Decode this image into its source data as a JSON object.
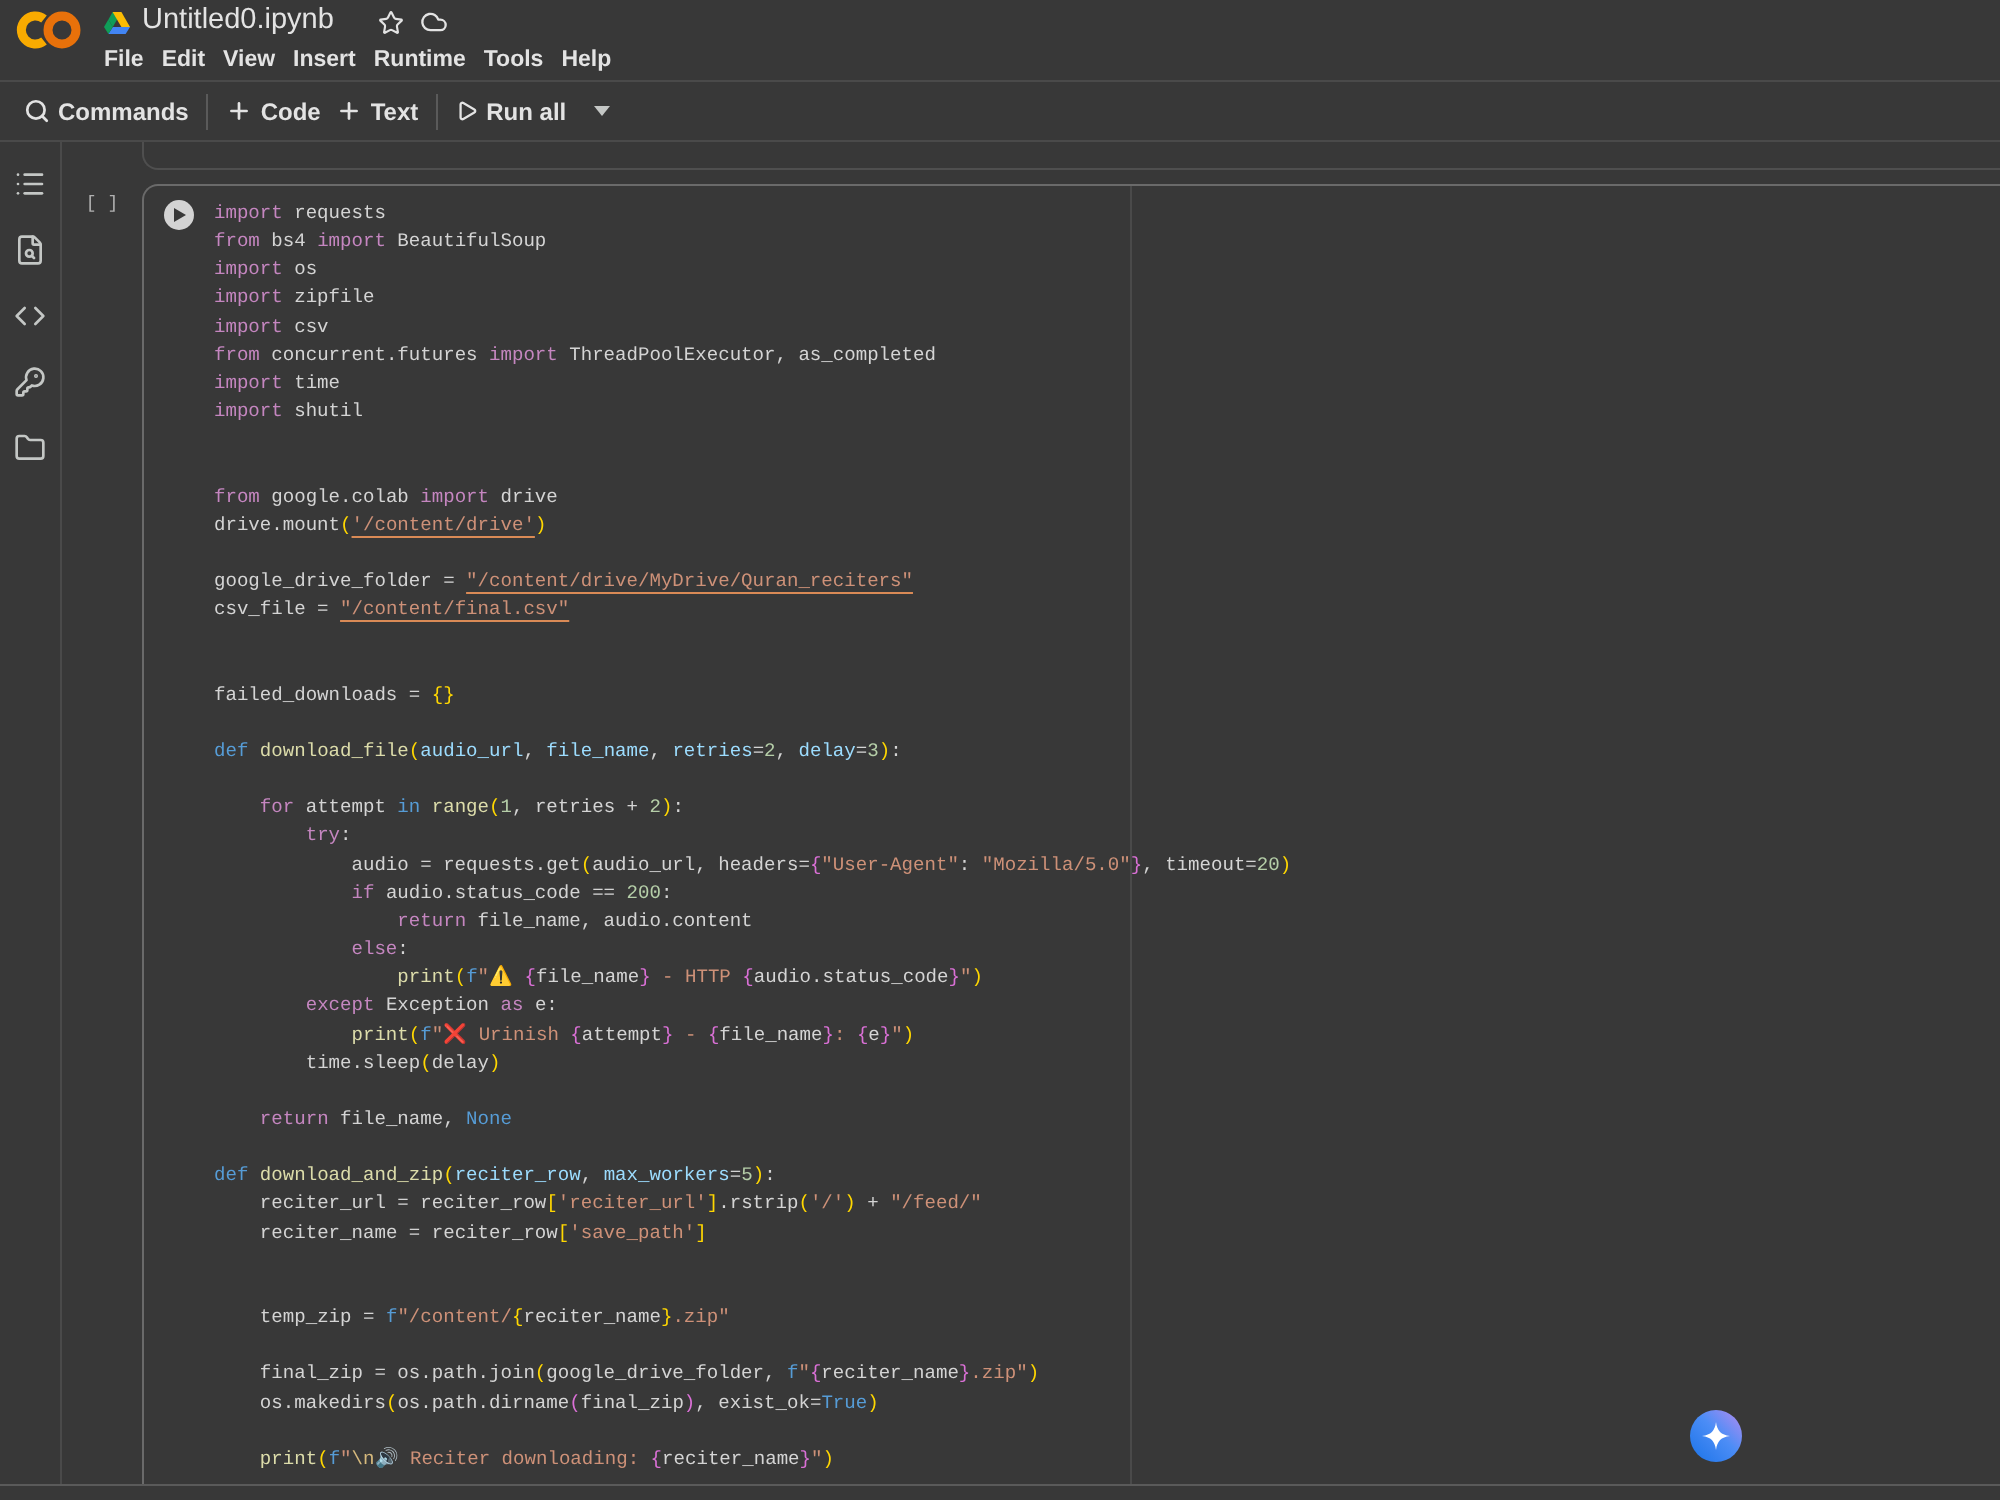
{
  "header": {
    "title": "Untitled0.ipynb",
    "menu": [
      "File",
      "Edit",
      "View",
      "Insert",
      "Runtime",
      "Tools",
      "Help"
    ]
  },
  "toolbar": [
    {
      "kind": "search",
      "label": "Commands"
    },
    {
      "kind": "add",
      "label": "Code"
    },
    {
      "kind": "add",
      "label": "Text"
    },
    {
      "kind": "run",
      "label": "Run all"
    }
  ],
  "cell": {
    "execution_count": "[ ]",
    "lines": [
      {
        "kind": "code",
        "tokens": [
          {
            "kind": "kw",
            "text": "import"
          },
          {
            "kind": "plain",
            "text": " requests"
          }
        ]
      },
      {
        "kind": "code",
        "tokens": [
          {
            "kind": "kw",
            "text": "from"
          },
          {
            "kind": "plain",
            "text": " bs4 "
          },
          {
            "kind": "kw",
            "text": "import"
          },
          {
            "kind": "plain",
            "text": " BeautifulSoup"
          }
        ]
      },
      {
        "kind": "code",
        "tokens": [
          {
            "kind": "kw",
            "text": "import"
          },
          {
            "kind": "plain",
            "text": " os"
          }
        ]
      },
      {
        "kind": "code",
        "tokens": [
          {
            "kind": "kw",
            "text": "import"
          },
          {
            "kind": "plain",
            "text": " zipfile"
          }
        ]
      },
      {
        "kind": "code",
        "tokens": [
          {
            "kind": "kw",
            "text": "import"
          },
          {
            "kind": "plain",
            "text": " csv"
          }
        ]
      },
      {
        "kind": "code",
        "tokens": [
          {
            "kind": "kw",
            "text": "from"
          },
          {
            "kind": "plain",
            "text": " concurrent.futures "
          },
          {
            "kind": "kw",
            "text": "import"
          },
          {
            "kind": "plain",
            "text": " ThreadPoolExecutor, as_completed"
          }
        ]
      },
      {
        "kind": "code",
        "tokens": [
          {
            "kind": "kw",
            "text": "import"
          },
          {
            "kind": "plain",
            "text": " time"
          }
        ]
      },
      {
        "kind": "code",
        "tokens": [
          {
            "kind": "kw",
            "text": "import"
          },
          {
            "kind": "plain",
            "text": " shutil"
          }
        ]
      },
      {
        "kind": "blank"
      },
      {
        "kind": "blank"
      },
      {
        "kind": "code",
        "tokens": [
          {
            "kind": "kw",
            "text": "from"
          },
          {
            "kind": "plain",
            "text": " google.colab "
          },
          {
            "kind": "kw",
            "text": "import"
          },
          {
            "kind": "plain",
            "text": " drive"
          }
        ]
      },
      {
        "kind": "code",
        "tokens": [
          {
            "kind": "plain",
            "text": "drive.mount"
          },
          {
            "kind": "b1",
            "text": "("
          },
          {
            "kind": "str",
            "text": "'/content/drive'",
            "underlined": true
          },
          {
            "kind": "b1",
            "text": ")"
          }
        ]
      },
      {
        "kind": "blank"
      },
      {
        "kind": "code",
        "tokens": [
          {
            "kind": "plain",
            "text": "google_drive_folder = "
          },
          {
            "kind": "str",
            "text": "\"/content/drive/MyDrive/Quran_reciters\"",
            "underlined": true
          }
        ]
      },
      {
        "kind": "code",
        "tokens": [
          {
            "kind": "plain",
            "text": "csv_file = "
          },
          {
            "kind": "str",
            "text": "\"/content/final.csv\"",
            "underlined": true
          }
        ]
      },
      {
        "kind": "blank"
      },
      {
        "kind": "blank"
      },
      {
        "kind": "code",
        "tokens": [
          {
            "kind": "plain",
            "text": "failed_downloads = "
          },
          {
            "kind": "b1",
            "text": "{}"
          }
        ]
      },
      {
        "kind": "blank"
      },
      {
        "kind": "code",
        "tokens": [
          {
            "kind": "const",
            "text": "def "
          },
          {
            "kind": "fn",
            "text": "download_file"
          },
          {
            "kind": "b1",
            "text": "("
          },
          {
            "kind": "param",
            "text": "audio_url"
          },
          {
            "kind": "plain",
            "text": ", "
          },
          {
            "kind": "param",
            "text": "file_name"
          },
          {
            "kind": "plain",
            "text": ", "
          },
          {
            "kind": "param",
            "text": "retries"
          },
          {
            "kind": "plain",
            "text": "="
          },
          {
            "kind": "num",
            "text": "2"
          },
          {
            "kind": "plain",
            "text": ", "
          },
          {
            "kind": "param",
            "text": "delay"
          },
          {
            "kind": "plain",
            "text": "="
          },
          {
            "kind": "num",
            "text": "3"
          },
          {
            "kind": "b1",
            "text": ")"
          },
          {
            "kind": "plain",
            "text": ":"
          }
        ]
      },
      {
        "kind": "blank"
      },
      {
        "kind": "code",
        "tokens": [
          {
            "kind": "kw",
            "text": "    for"
          },
          {
            "kind": "plain",
            "text": " attempt "
          },
          {
            "kind": "const",
            "text": "in "
          },
          {
            "kind": "fn",
            "text": "range"
          },
          {
            "kind": "b1",
            "text": "("
          },
          {
            "kind": "num",
            "text": "1"
          },
          {
            "kind": "plain",
            "text": ", retries + "
          },
          {
            "kind": "num",
            "text": "2"
          },
          {
            "kind": "b1",
            "text": ")"
          },
          {
            "kind": "plain",
            "text": ":"
          }
        ]
      },
      {
        "kind": "code",
        "tokens": [
          {
            "kind": "kw",
            "text": "        try"
          },
          {
            "kind": "plain",
            "text": ":"
          }
        ]
      },
      {
        "kind": "code",
        "tokens": [
          {
            "kind": "plain",
            "text": "            audio = requests.get"
          },
          {
            "kind": "b1",
            "text": "("
          },
          {
            "kind": "plain",
            "text": "audio_url, headers="
          },
          {
            "kind": "b2",
            "text": "{"
          },
          {
            "kind": "str",
            "text": "\"User-Agent\""
          },
          {
            "kind": "plain",
            "text": ": "
          },
          {
            "kind": "str",
            "text": "\"Mozilla/5.0\""
          },
          {
            "kind": "b2",
            "text": "}"
          },
          {
            "kind": "plain",
            "text": ", timeout="
          },
          {
            "kind": "num",
            "text": "20"
          },
          {
            "kind": "b1",
            "text": ")"
          }
        ]
      },
      {
        "kind": "code",
        "tokens": [
          {
            "kind": "kw",
            "text": "            if"
          },
          {
            "kind": "plain",
            "text": " audio.status_code == "
          },
          {
            "kind": "num",
            "text": "200"
          },
          {
            "kind": "plain",
            "text": ":"
          }
        ]
      },
      {
        "kind": "code",
        "tokens": [
          {
            "kind": "kw",
            "text": "                return"
          },
          {
            "kind": "plain",
            "text": " file_name, audio.content"
          }
        ]
      },
      {
        "kind": "code",
        "tokens": [
          {
            "kind": "kw",
            "text": "            else"
          },
          {
            "kind": "plain",
            "text": ":"
          }
        ]
      },
      {
        "kind": "code",
        "tokens": [
          {
            "kind": "fn",
            "text": "                print"
          },
          {
            "kind": "b1",
            "text": "("
          },
          {
            "kind": "const",
            "text": "f"
          },
          {
            "kind": "str",
            "text": "\"⚠️ "
          },
          {
            "kind": "b2",
            "text": "{"
          },
          {
            "kind": "plain",
            "text": "file_name"
          },
          {
            "kind": "b2",
            "text": "}"
          },
          {
            "kind": "str",
            "text": " - HTTP "
          },
          {
            "kind": "b2",
            "text": "{"
          },
          {
            "kind": "plain",
            "text": "audio.status_code"
          },
          {
            "kind": "b2",
            "text": "}"
          },
          {
            "kind": "str",
            "text": "\""
          },
          {
            "kind": "b1",
            "text": ")"
          }
        ]
      },
      {
        "kind": "code",
        "tokens": [
          {
            "kind": "kw",
            "text": "        except"
          },
          {
            "kind": "plain",
            "text": " Exception "
          },
          {
            "kind": "kw",
            "text": "as"
          },
          {
            "kind": "plain",
            "text": " e:"
          }
        ]
      },
      {
        "kind": "code",
        "tokens": [
          {
            "kind": "fn",
            "text": "            print"
          },
          {
            "kind": "b1",
            "text": "("
          },
          {
            "kind": "const",
            "text": "f"
          },
          {
            "kind": "str",
            "text": "\"❌ Urinish "
          },
          {
            "kind": "b2",
            "text": "{"
          },
          {
            "kind": "plain",
            "text": "attempt"
          },
          {
            "kind": "b2",
            "text": "}"
          },
          {
            "kind": "str",
            "text": " - "
          },
          {
            "kind": "b2",
            "text": "{"
          },
          {
            "kind": "plain",
            "text": "file_name"
          },
          {
            "kind": "b2",
            "text": "}"
          },
          {
            "kind": "str",
            "text": ": "
          },
          {
            "kind": "b2",
            "text": "{"
          },
          {
            "kind": "plain",
            "text": "e"
          },
          {
            "kind": "b2",
            "text": "}"
          },
          {
            "kind": "str",
            "text": "\""
          },
          {
            "kind": "b1",
            "text": ")"
          }
        ]
      },
      {
        "kind": "code",
        "tokens": [
          {
            "kind": "plain",
            "text": "        time.sleep"
          },
          {
            "kind": "b1",
            "text": "("
          },
          {
            "kind": "plain",
            "text": "delay"
          },
          {
            "kind": "b1",
            "text": ")"
          }
        ]
      },
      {
        "kind": "blank"
      },
      {
        "kind": "code",
        "tokens": [
          {
            "kind": "kw",
            "text": "    return"
          },
          {
            "kind": "plain",
            "text": " file_name, "
          },
          {
            "kind": "const",
            "text": "None"
          }
        ]
      },
      {
        "kind": "blank"
      },
      {
        "kind": "code",
        "tokens": [
          {
            "kind": "const",
            "text": "def "
          },
          {
            "kind": "fn",
            "text": "download_and_zip"
          },
          {
            "kind": "b1",
            "text": "("
          },
          {
            "kind": "param",
            "text": "reciter_row"
          },
          {
            "kind": "plain",
            "text": ", "
          },
          {
            "kind": "param",
            "text": "max_workers"
          },
          {
            "kind": "plain",
            "text": "="
          },
          {
            "kind": "num",
            "text": "5"
          },
          {
            "kind": "b1",
            "text": ")"
          },
          {
            "kind": "plain",
            "text": ":"
          }
        ]
      },
      {
        "kind": "code",
        "tokens": [
          {
            "kind": "plain",
            "text": "    reciter_url = reciter_row"
          },
          {
            "kind": "b1",
            "text": "["
          },
          {
            "kind": "str",
            "text": "'reciter_url'"
          },
          {
            "kind": "b1",
            "text": "]"
          },
          {
            "kind": "plain",
            "text": ".rstrip"
          },
          {
            "kind": "b1",
            "text": "("
          },
          {
            "kind": "str",
            "text": "'/'"
          },
          {
            "kind": "b1",
            "text": ")"
          },
          {
            "kind": "plain",
            "text": " + "
          },
          {
            "kind": "str",
            "text": "\"/feed/\""
          }
        ]
      },
      {
        "kind": "code",
        "tokens": [
          {
            "kind": "plain",
            "text": "    reciter_name = reciter_row"
          },
          {
            "kind": "b1",
            "text": "["
          },
          {
            "kind": "str",
            "text": "'save_path'"
          },
          {
            "kind": "b1",
            "text": "]"
          }
        ]
      },
      {
        "kind": "blank"
      },
      {
        "kind": "blank"
      },
      {
        "kind": "code",
        "tokens": [
          {
            "kind": "plain",
            "text": "    temp_zip = "
          },
          {
            "kind": "const",
            "text": "f"
          },
          {
            "kind": "str",
            "text": "\"/content/"
          },
          {
            "kind": "b1",
            "text": "{"
          },
          {
            "kind": "plain",
            "text": "reciter_name"
          },
          {
            "kind": "b1",
            "text": "}"
          },
          {
            "kind": "str",
            "text": ".zip\""
          }
        ]
      },
      {
        "kind": "blank"
      },
      {
        "kind": "code",
        "tokens": [
          {
            "kind": "plain",
            "text": "    final_zip = os.path.join"
          },
          {
            "kind": "b1",
            "text": "("
          },
          {
            "kind": "plain",
            "text": "google_drive_folder, "
          },
          {
            "kind": "const",
            "text": "f"
          },
          {
            "kind": "str",
            "text": "\""
          },
          {
            "kind": "b2",
            "text": "{"
          },
          {
            "kind": "plain",
            "text": "reciter_name"
          },
          {
            "kind": "b2",
            "text": "}"
          },
          {
            "kind": "str",
            "text": ".zip\""
          },
          {
            "kind": "b1",
            "text": ")"
          }
        ]
      },
      {
        "kind": "code",
        "tokens": [
          {
            "kind": "plain",
            "text": "    os.makedirs"
          },
          {
            "kind": "b1",
            "text": "("
          },
          {
            "kind": "plain",
            "text": "os.path.dirname"
          },
          {
            "kind": "b2",
            "text": "("
          },
          {
            "kind": "plain",
            "text": "final_zip"
          },
          {
            "kind": "b2",
            "text": ")"
          },
          {
            "kind": "plain",
            "text": ", exist_ok="
          },
          {
            "kind": "const",
            "text": "True"
          },
          {
            "kind": "b1",
            "text": ")"
          }
        ]
      },
      {
        "kind": "blank"
      },
      {
        "kind": "code",
        "tokens": [
          {
            "kind": "fn",
            "text": "    print"
          },
          {
            "kind": "b1",
            "text": "("
          },
          {
            "kind": "const",
            "text": "f"
          },
          {
            "kind": "str",
            "text": "\""
          },
          {
            "kind": "escape",
            "text": "\\n"
          },
          {
            "kind": "str",
            "text": "🔊 Reciter downloading: "
          },
          {
            "kind": "b2",
            "text": "{"
          },
          {
            "kind": "plain",
            "text": "reciter_name"
          },
          {
            "kind": "b2",
            "text": "}"
          },
          {
            "kind": "str",
            "text": "\""
          },
          {
            "kind": "b1",
            "text": ")"
          }
        ]
      }
    ]
  }
}
